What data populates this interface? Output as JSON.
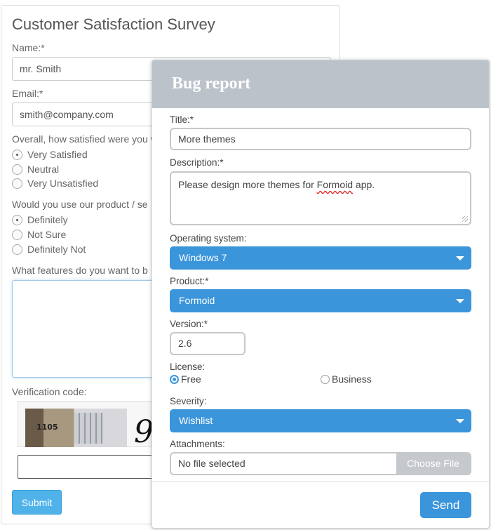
{
  "survey": {
    "title": "Customer Satisfaction Survey",
    "name_label": "Name:*",
    "name_value": "mr. Smith",
    "email_label": "Email:*",
    "email_value": "smith@company.com",
    "q1_label": "Overall, how satisfied were you w",
    "q1_options": [
      "Very Satisfied",
      "Neutral",
      "Very Unsatisfied"
    ],
    "q2_label": "Would you use our product / se",
    "q2_options": [
      "Definitely",
      "Not Sure",
      "Definitely Not"
    ],
    "q3_label": "What features do you want to b",
    "verification_label": "Verification code:",
    "captcha_house_number": "1105",
    "captcha_digit": "9",
    "submit_label": "Submit"
  },
  "bug_report": {
    "title": "Bug report",
    "title_label": "Title:*",
    "title_value": "More themes",
    "description_label": "Description:*",
    "description_before": "Please design more themes for ",
    "description_misspelled": "Formoid",
    "description_after": " app.",
    "os_label": "Operating system:",
    "os_value": "Windows 7",
    "product_label": "Product:*",
    "product_value": "Formoid",
    "version_label": "Version:*",
    "version_value": "2.6",
    "license_label": "License:",
    "license_options": [
      "Free",
      "Business"
    ],
    "severity_label": "Severity:",
    "severity_value": "Wishlist",
    "attachments_label": "Attachments:",
    "file_status": "No file selected",
    "choose_file_label": "Choose File",
    "send_label": "Send"
  },
  "colors": {
    "accent": "#3b95db",
    "header_bg": "#bcc2c9",
    "submit_bg": "#4fb3ea"
  }
}
